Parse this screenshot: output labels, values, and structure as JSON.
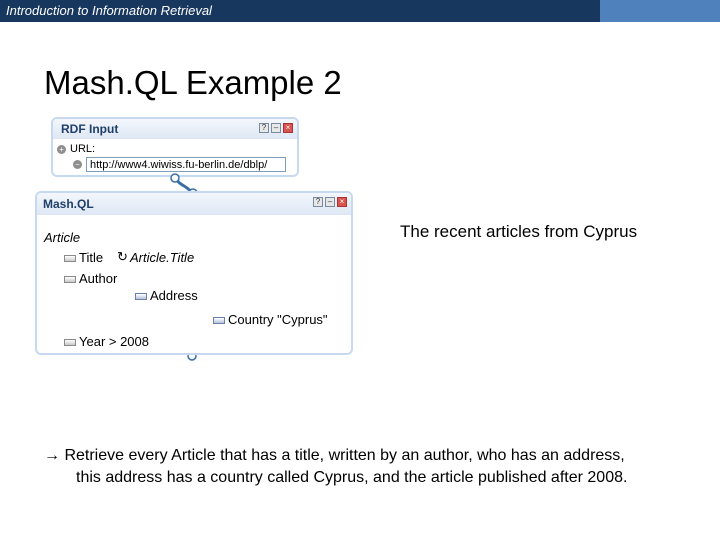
{
  "header": {
    "course_title": "Introduction to Information Retrieval",
    "colors": {
      "bar": "#17375e",
      "bar_accent": "#4f81bd"
    }
  },
  "slide": {
    "title": "Mash.QL Example 2"
  },
  "rdf_panel": {
    "title": "RDF Input",
    "url_label": "URL:",
    "url_value": "http://www4.wiwiss.fu-berlin.de/dblp/",
    "icons": [
      "help-icon",
      "minimize-icon",
      "close-icon"
    ]
  },
  "mashql_panel": {
    "title": "Mash.QL",
    "subject": "Article",
    "rows": [
      {
        "property": "Title",
        "object": "Article.Title",
        "object_icon": "refresh-icon"
      },
      {
        "property": "Author"
      },
      {
        "property": "Address"
      },
      {
        "property": "Country \"Cyprus\""
      },
      {
        "property": "Year > 2008"
      }
    ]
  },
  "caption": "The recent articles from Cyprus",
  "explanation": {
    "arrow": "→",
    "line1": "Retrieve every Article that has a title, written by an author, who has an address,",
    "line2": "this address has a country called Cyprus, and the article published after 2008."
  }
}
